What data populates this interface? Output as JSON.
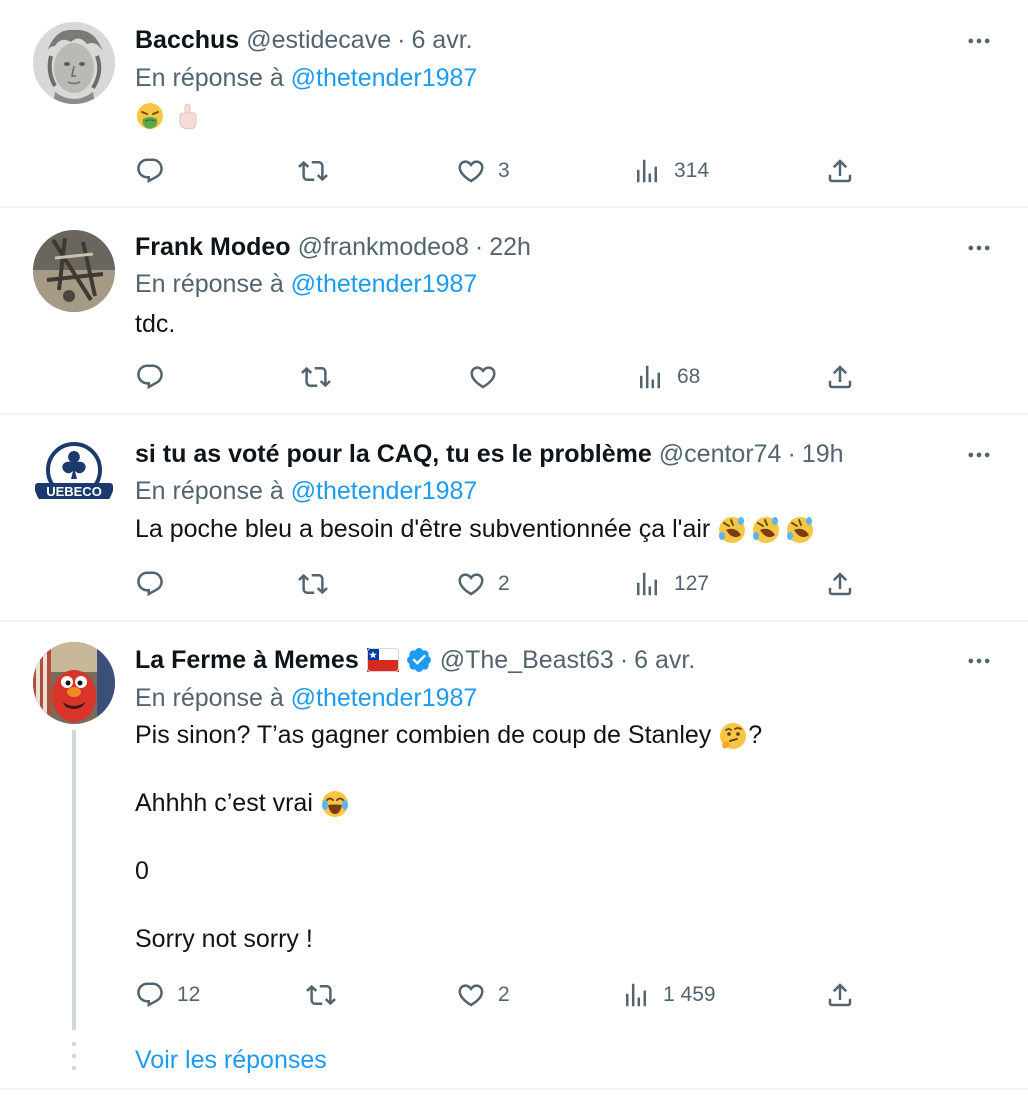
{
  "tweets": [
    {
      "name": "Bacchus",
      "handle": "@estidecave",
      "sep": "·",
      "time": "6 avr.",
      "reply_prefix": "En réponse à ",
      "reply_mention": "@thetender1987",
      "text": "",
      "replies": "",
      "retweets": "",
      "likes": "3",
      "views": "314"
    },
    {
      "name": "Frank Modeo",
      "handle": "@frankmodeo8",
      "sep": "·",
      "time": "22h",
      "reply_prefix": "En réponse à ",
      "reply_mention": "@thetender1987",
      "text": "tdc.",
      "replies": "",
      "retweets": "",
      "likes": "",
      "views": "68"
    },
    {
      "name": "si tu as voté pour la CAQ, tu es le problème",
      "handle": "@centor74",
      "sep": "·",
      "time": "19h",
      "reply_prefix": "En réponse à ",
      "reply_mention": "@thetender1987",
      "text": "La poche bleu a besoin d'être subventionnée ça l'air ",
      "avatar_text": "UEBECO",
      "replies": "",
      "retweets": "",
      "likes": "2",
      "views": "127"
    },
    {
      "name": "La Ferme à Memes",
      "handle": "@The_Beast63",
      "sep": "·",
      "time": "6 avr.",
      "reply_prefix": "En réponse à ",
      "reply_mention": "@thetender1987",
      "line1_a": "Pis sinon? T’as gagner combien de coup de Stanley ",
      "line1_b": "?",
      "line2": "Ahhhh c’est vrai ",
      "line3": "0",
      "line4": "Sorry not sorry !",
      "replies": "12",
      "retweets": "",
      "likes": "2",
      "views": "1 459"
    }
  ],
  "show_replies": "Voir les réponses",
  "colors": {
    "accent": "#1d9bf0",
    "secondary": "#536471",
    "border": "#eff3f4"
  }
}
